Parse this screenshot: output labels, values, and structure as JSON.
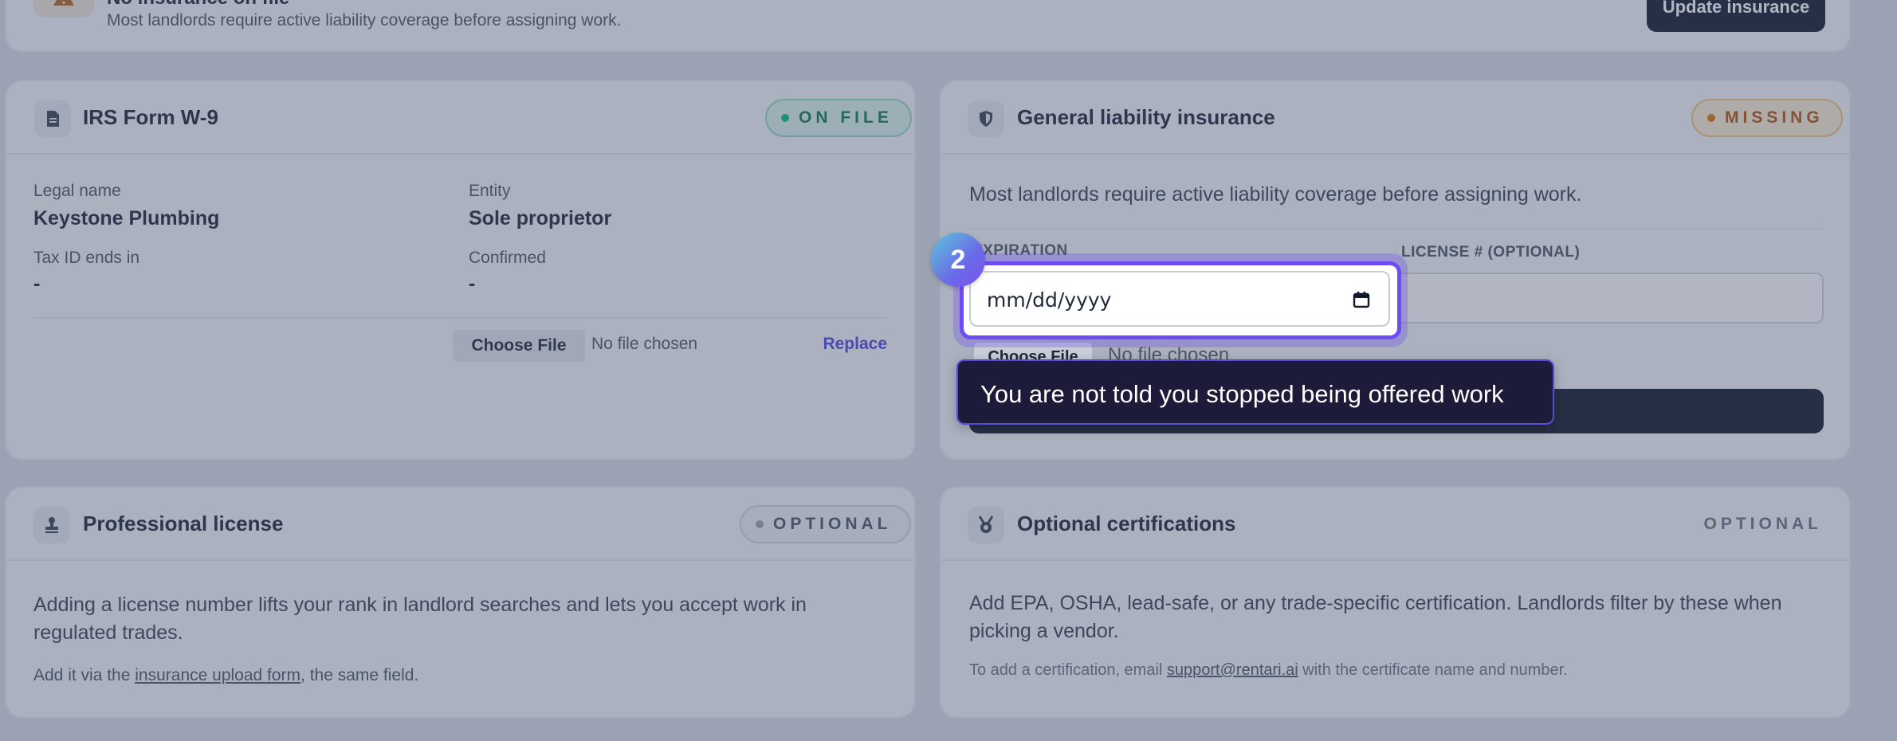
{
  "banner": {
    "title": "No insurance on file",
    "subtitle": "Most landlords require active liability coverage before assigning work.",
    "action_label": "Update insurance"
  },
  "w9": {
    "title": "IRS Form W-9",
    "status": "ON FILE",
    "legal_name_label": "Legal name",
    "legal_name_value": "Keystone Plumbing",
    "entity_label": "Entity",
    "entity_value": "Sole proprietor",
    "tax_id_label": "Tax ID ends in",
    "tax_id_value": "-",
    "confirmed_label": "Confirmed",
    "confirmed_value": "-",
    "choose_file_label": "Choose File",
    "no_file_label": "No file chosen",
    "replace_label": "Replace"
  },
  "insurance": {
    "title": "General liability insurance",
    "status": "MISSING",
    "description": "Most landlords require active liability coverage before assigning work.",
    "expiration_label": "EXPIRATION",
    "expiration_placeholder": "mm/dd/yyyy",
    "license_label": "LICENSE # (OPTIONAL)",
    "license_value": "",
    "choose_file_label": "Choose File",
    "no_file_label": "No file chosen"
  },
  "license": {
    "title": "Professional license",
    "status": "OPTIONAL",
    "description": "Adding a license number lifts your rank in landlord searches and lets you accept work in regulated trades.",
    "note_prefix": "Add it via the ",
    "note_link": "insurance upload form",
    "note_suffix": ", the same field."
  },
  "certifications": {
    "title": "Optional certifications",
    "status": "OPTIONAL",
    "description": "Add EPA, OSHA, lead-safe, or any trade-specific certification. Landlords filter by these when picking a vendor.",
    "note_prefix": "To add a certification, email ",
    "note_link": "support@rentari.ai",
    "note_suffix": " with the certificate name and number."
  },
  "tour": {
    "step_number": "2",
    "tooltip": "You are not told you stopped being offered work"
  },
  "colors": {
    "on_file": "#10b981",
    "missing": "#d97706",
    "optional": "#9ca3af",
    "link": "#4f46e5",
    "highlight": "#6d4df2",
    "dark_button": "#0f172a"
  }
}
